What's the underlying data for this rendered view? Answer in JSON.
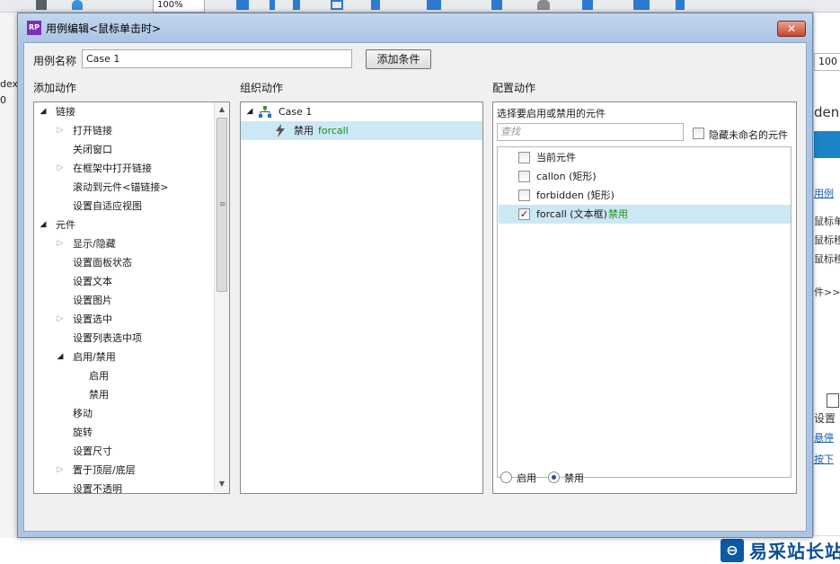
{
  "background": {
    "zoom": "100%",
    "left_fragment_1": "dex",
    "left_fragment_2": "0",
    "right_field": "100",
    "right_title": "den",
    "right_link_1": "用例",
    "right_item_1": "鼠标单击",
    "right_item_2": "鼠标移入",
    "right_item_3": "鼠标移出",
    "right_more": "件>>>",
    "right_settings": "设置",
    "right_link_2": "悬停",
    "right_link_3": "按下",
    "watermark_text": "易采站长站"
  },
  "dialog": {
    "icon_text": "RP",
    "title": "用例编辑<鼠标单击时>",
    "close_symbol": "✕"
  },
  "case_name": {
    "label": "用例名称",
    "value": "Case 1",
    "add_condition_button": "添加条件"
  },
  "add_actions": {
    "header": "添加动作",
    "items": [
      {
        "label": "链接",
        "level": 0,
        "arrow": "open"
      },
      {
        "label": "打开链接",
        "level": 1,
        "arrow": "closed"
      },
      {
        "label": "关闭窗口",
        "level": 1,
        "arrow": "none"
      },
      {
        "label": "在框架中打开链接",
        "level": 1,
        "arrow": "closed"
      },
      {
        "label": "滚动到元件<锚链接>",
        "level": 1,
        "arrow": "none"
      },
      {
        "label": "设置自适应视图",
        "level": 1,
        "arrow": "none"
      },
      {
        "label": "元件",
        "level": 0,
        "arrow": "open"
      },
      {
        "label": "显示/隐藏",
        "level": 1,
        "arrow": "closed"
      },
      {
        "label": "设置面板状态",
        "level": 1,
        "arrow": "none"
      },
      {
        "label": "设置文本",
        "level": 1,
        "arrow": "none"
      },
      {
        "label": "设置图片",
        "level": 1,
        "arrow": "none"
      },
      {
        "label": "设置选中",
        "level": 1,
        "arrow": "closed"
      },
      {
        "label": "设置列表选中项",
        "level": 1,
        "arrow": "none"
      },
      {
        "label": "启用/禁用",
        "level": 1,
        "arrow": "open"
      },
      {
        "label": "启用",
        "level": 2,
        "arrow": "none"
      },
      {
        "label": "禁用",
        "level": 2,
        "arrow": "none"
      },
      {
        "label": "移动",
        "level": 1,
        "arrow": "none"
      },
      {
        "label": "旋转",
        "level": 1,
        "arrow": "none"
      },
      {
        "label": "设置尺寸",
        "level": 1,
        "arrow": "none"
      },
      {
        "label": "置于顶层/底层",
        "level": 1,
        "arrow": "closed"
      },
      {
        "label": "设置不透明",
        "level": 1,
        "arrow": "none"
      }
    ]
  },
  "organize_actions": {
    "header": "组织动作",
    "case_label": "Case 1",
    "action_label": "禁用",
    "action_target": "forcall"
  },
  "configure_actions": {
    "header": "配置动作",
    "subheader": "选择要启用或禁用的元件",
    "search_placeholder": "查找",
    "hide_unnamed_label": "隐藏未命名的元件",
    "hide_unnamed_checked": false,
    "widgets": [
      {
        "label": "当前元件",
        "checked": false,
        "status": ""
      },
      {
        "label": "callon (矩形)",
        "checked": false,
        "status": ""
      },
      {
        "label": "forbidden (矩形)",
        "checked": false,
        "status": ""
      },
      {
        "label": "forcall (文本框)",
        "checked": true,
        "status": "禁用"
      }
    ],
    "radio_enable": "启用",
    "radio_disable": "禁用",
    "selected_radio": "禁用"
  },
  "colors": {
    "titlebar": "#abc5e2",
    "selection": "#cce8f4",
    "status_green": "#1e8e1e",
    "close_red": "#c7452c"
  }
}
